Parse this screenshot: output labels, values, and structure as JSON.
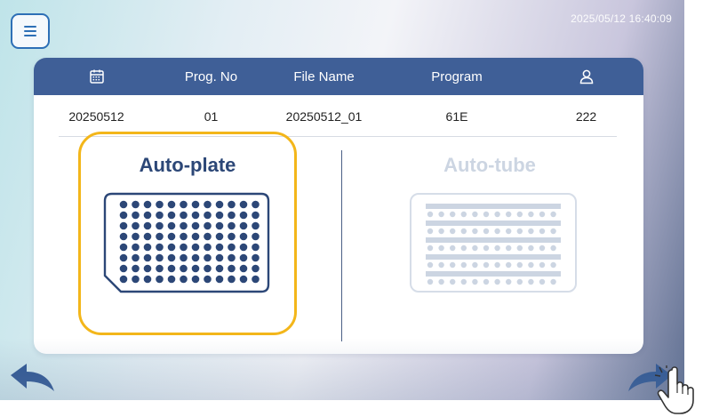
{
  "datetime": "2025/05/12 16:40:09",
  "menu": {
    "icon": "hamburger-menu-icon"
  },
  "table": {
    "headers": {
      "date_icon": "calendar-icon",
      "prog_no": "Prog. No",
      "file_name": "File Name",
      "program": "Program",
      "user_icon": "user-icon"
    },
    "row": {
      "date": "20250512",
      "prog_no": "01",
      "file_name": "20250512_01",
      "program": "61E",
      "user": "222"
    }
  },
  "options": {
    "plate": {
      "label": "Auto-plate",
      "icon": "96-well-plate-icon",
      "selected": true
    },
    "tube": {
      "label": "Auto-tube",
      "icon": "tube-rack-icon",
      "enabled": false
    }
  },
  "nav": {
    "back_icon": "back-arrow-icon",
    "next_icon": "next-arrow-icon"
  },
  "colors": {
    "header_bg": "#3f5f97",
    "accent_blue": "#2d6fb6",
    "selection_border": "#f3b61a",
    "plate_dots": "#2c4777",
    "disabled": "#ccd5e2"
  }
}
